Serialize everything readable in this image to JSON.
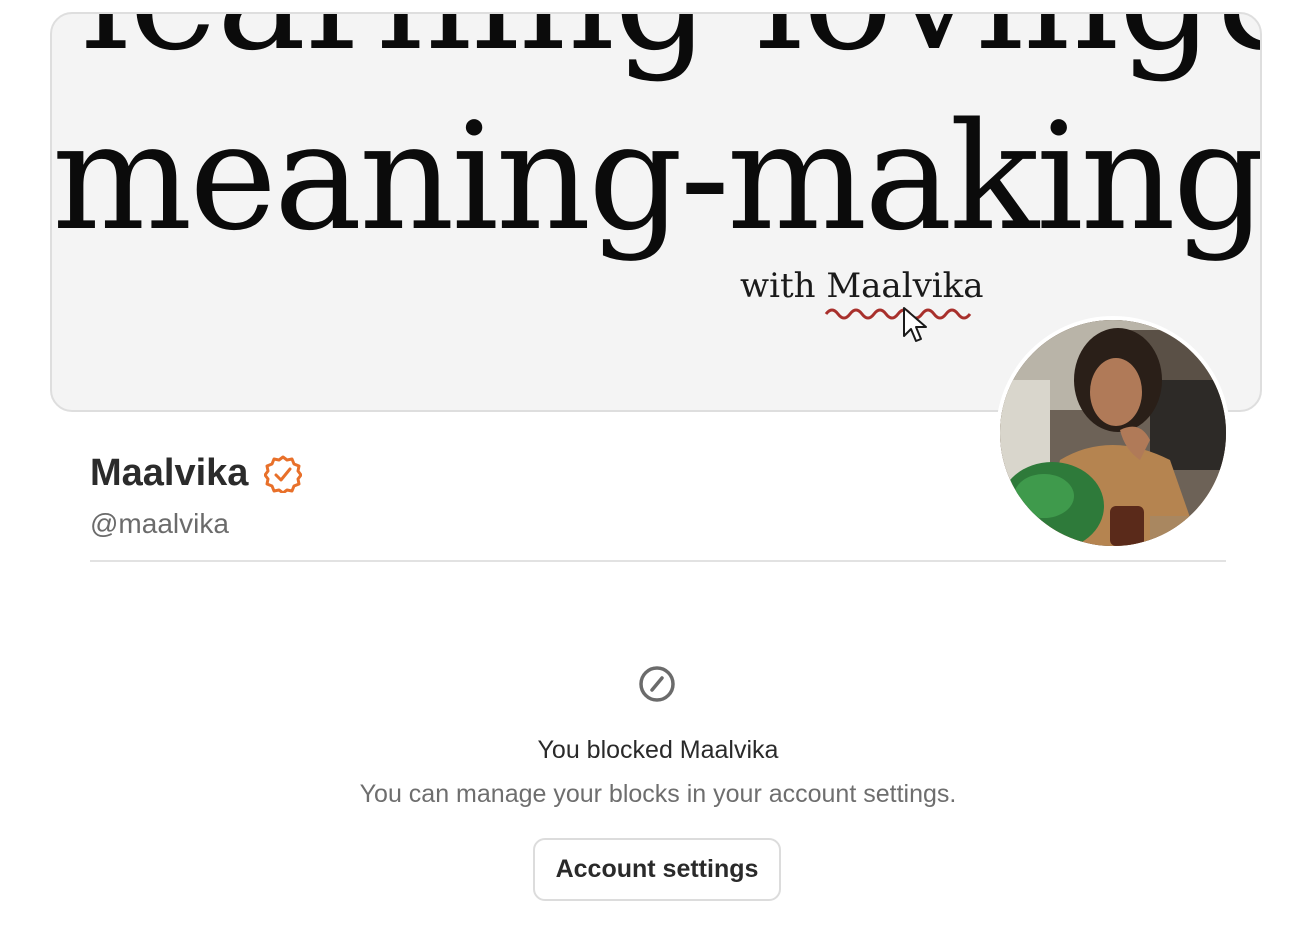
{
  "banner": {
    "line_top": "learning loving&",
    "line_main": "meaning-making",
    "line_sub": "with Maalvika"
  },
  "profile": {
    "name": "Maalvika",
    "handle": "@maalvika",
    "verified_icon": "verified-badge-icon",
    "accent_color": "#e8702a"
  },
  "blocked": {
    "icon": "blocked-icon",
    "title": "You blocked Maalvika",
    "message": "You can manage your blocks in your account settings.",
    "button_label": "Account settings"
  }
}
